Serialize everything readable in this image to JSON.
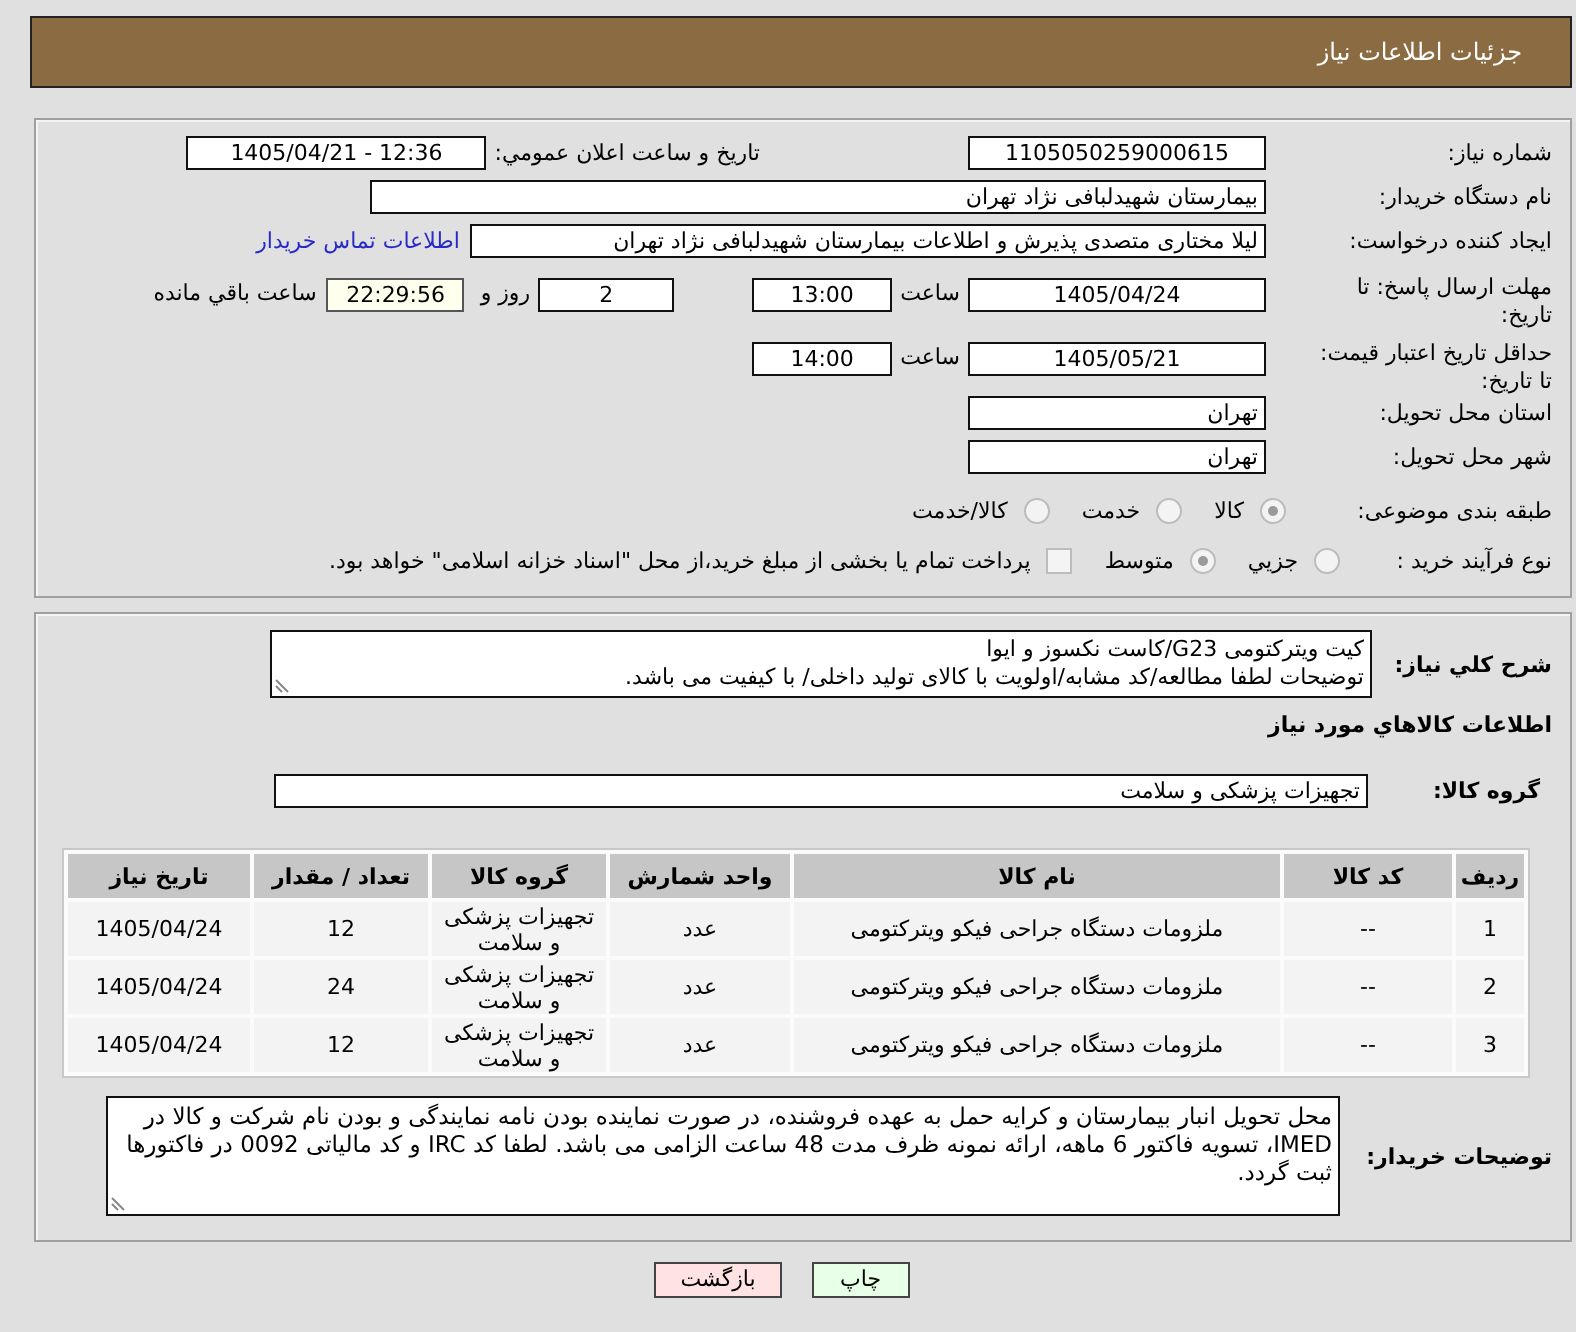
{
  "header": {
    "title": "جزئیات اطلاعات نیاز"
  },
  "need_info": {
    "need_number": {
      "label": "شماره نیاز:",
      "value": "1105050259000615"
    },
    "announce_datetime": {
      "label": "تاریخ و ساعت اعلان عمومي:",
      "value": "1405/04/21 - 12:36"
    },
    "buyer_org": {
      "label": "نام دستگاه خریدار:",
      "value": "بیمارستان شهیدلبافی نژاد تهران"
    },
    "requester": {
      "label": "ایجاد کننده درخواست:",
      "value": "لیلا مختاری متصدی پذیرش و اطلاعات بیمارستان شهیدلبافی نژاد تهران",
      "link": "اطلاعات تماس خریدار"
    },
    "response_deadline": {
      "label": "مهلت ارسال پاسخ: تا تاریخ:",
      "date": "1405/04/24",
      "time_label": "ساعت",
      "time": "13:00",
      "days": "2",
      "days_label": "روز و",
      "remaining": "22:29:56",
      "remaining_label": "ساعت باقي مانده"
    },
    "price_validity": {
      "label": "حداقل تاریخ اعتبار قیمت: تا تاریخ:",
      "date": "1405/05/21",
      "time_label": "ساعت",
      "time": "14:00"
    },
    "delivery_province": {
      "label": "استان محل تحویل:",
      "value": "تهران"
    },
    "delivery_city": {
      "label": "شهر محل تحویل:",
      "value": "تهران"
    },
    "subject_category": {
      "label": "طبقه بندی موضوعی:",
      "options": [
        {
          "label": "کالا",
          "selected": true
        },
        {
          "label": "خدمت",
          "selected": false
        },
        {
          "label": "کالا/خدمت",
          "selected": false
        }
      ]
    },
    "purchase_type": {
      "label": "نوع فرآیند خرید :",
      "options": [
        {
          "label": "جزيي",
          "selected": false
        },
        {
          "label": "متوسط",
          "selected": true
        }
      ],
      "treasury_payment": {
        "label": "پرداخت تمام یا بخشی از مبلغ خرید،از محل \"اسناد خزانه اسلامی\" خواهد بود.",
        "checked": false
      }
    }
  },
  "goods": {
    "description": {
      "label": "شرح کلي نیاز:",
      "value": "کیت ویترکتومی G23/کاست نکسوز و ایوا\nتوضیحات لطفا مطالعه/کد مشابه/اولویت با کالای تولید داخلی/ با کیفیت می باشد."
    },
    "heading": "اطلاعات کالاهاي مورد نیاز",
    "group": {
      "label": "گروه کالا:",
      "value": "تجهیزات پزشکی و سلامت"
    },
    "table": {
      "columns": [
        "ردیف",
        "کد کالا",
        "نام کالا",
        "واحد شمارش",
        "گروه کالا",
        "تعداد / مقدار",
        "تاریخ نیاز"
      ],
      "rows": [
        [
          "1",
          "--",
          "ملزومات دستگاه جراحی فیکو ویترکتومی",
          "عدد",
          "تجهیزات پزشکی و سلامت",
          "12",
          "1405/04/24"
        ],
        [
          "2",
          "--",
          "ملزومات دستگاه جراحی فیکو ویترکتومی",
          "عدد",
          "تجهیزات پزشکی و سلامت",
          "24",
          "1405/04/24"
        ],
        [
          "3",
          "--",
          "ملزومات دستگاه جراحی فیکو ویترکتومی",
          "عدد",
          "تجهیزات پزشکی و سلامت",
          "12",
          "1405/04/24"
        ]
      ]
    },
    "buyer_notes": {
      "label": "توضیحات خریدار:",
      "value": "محل تحویل انبار بیمارستان و کرایه حمل به عهده فروشنده، در صورت نماینده بودن نامه نمایندگی و بودن نام شرکت و کالا در IMED، تسویه فاکتور 6 ماهه، ارائه نمونه ظرف مدت 48 ساعت الزامی می باشد. لطفا کد IRC و کد مالیاتی 0092 در فاکتورها ثبت گردد."
    }
  },
  "buttons": [
    {
      "label": "چاپ",
      "kind": "print"
    },
    {
      "label": "بازگشت",
      "kind": "back"
    }
  ]
}
